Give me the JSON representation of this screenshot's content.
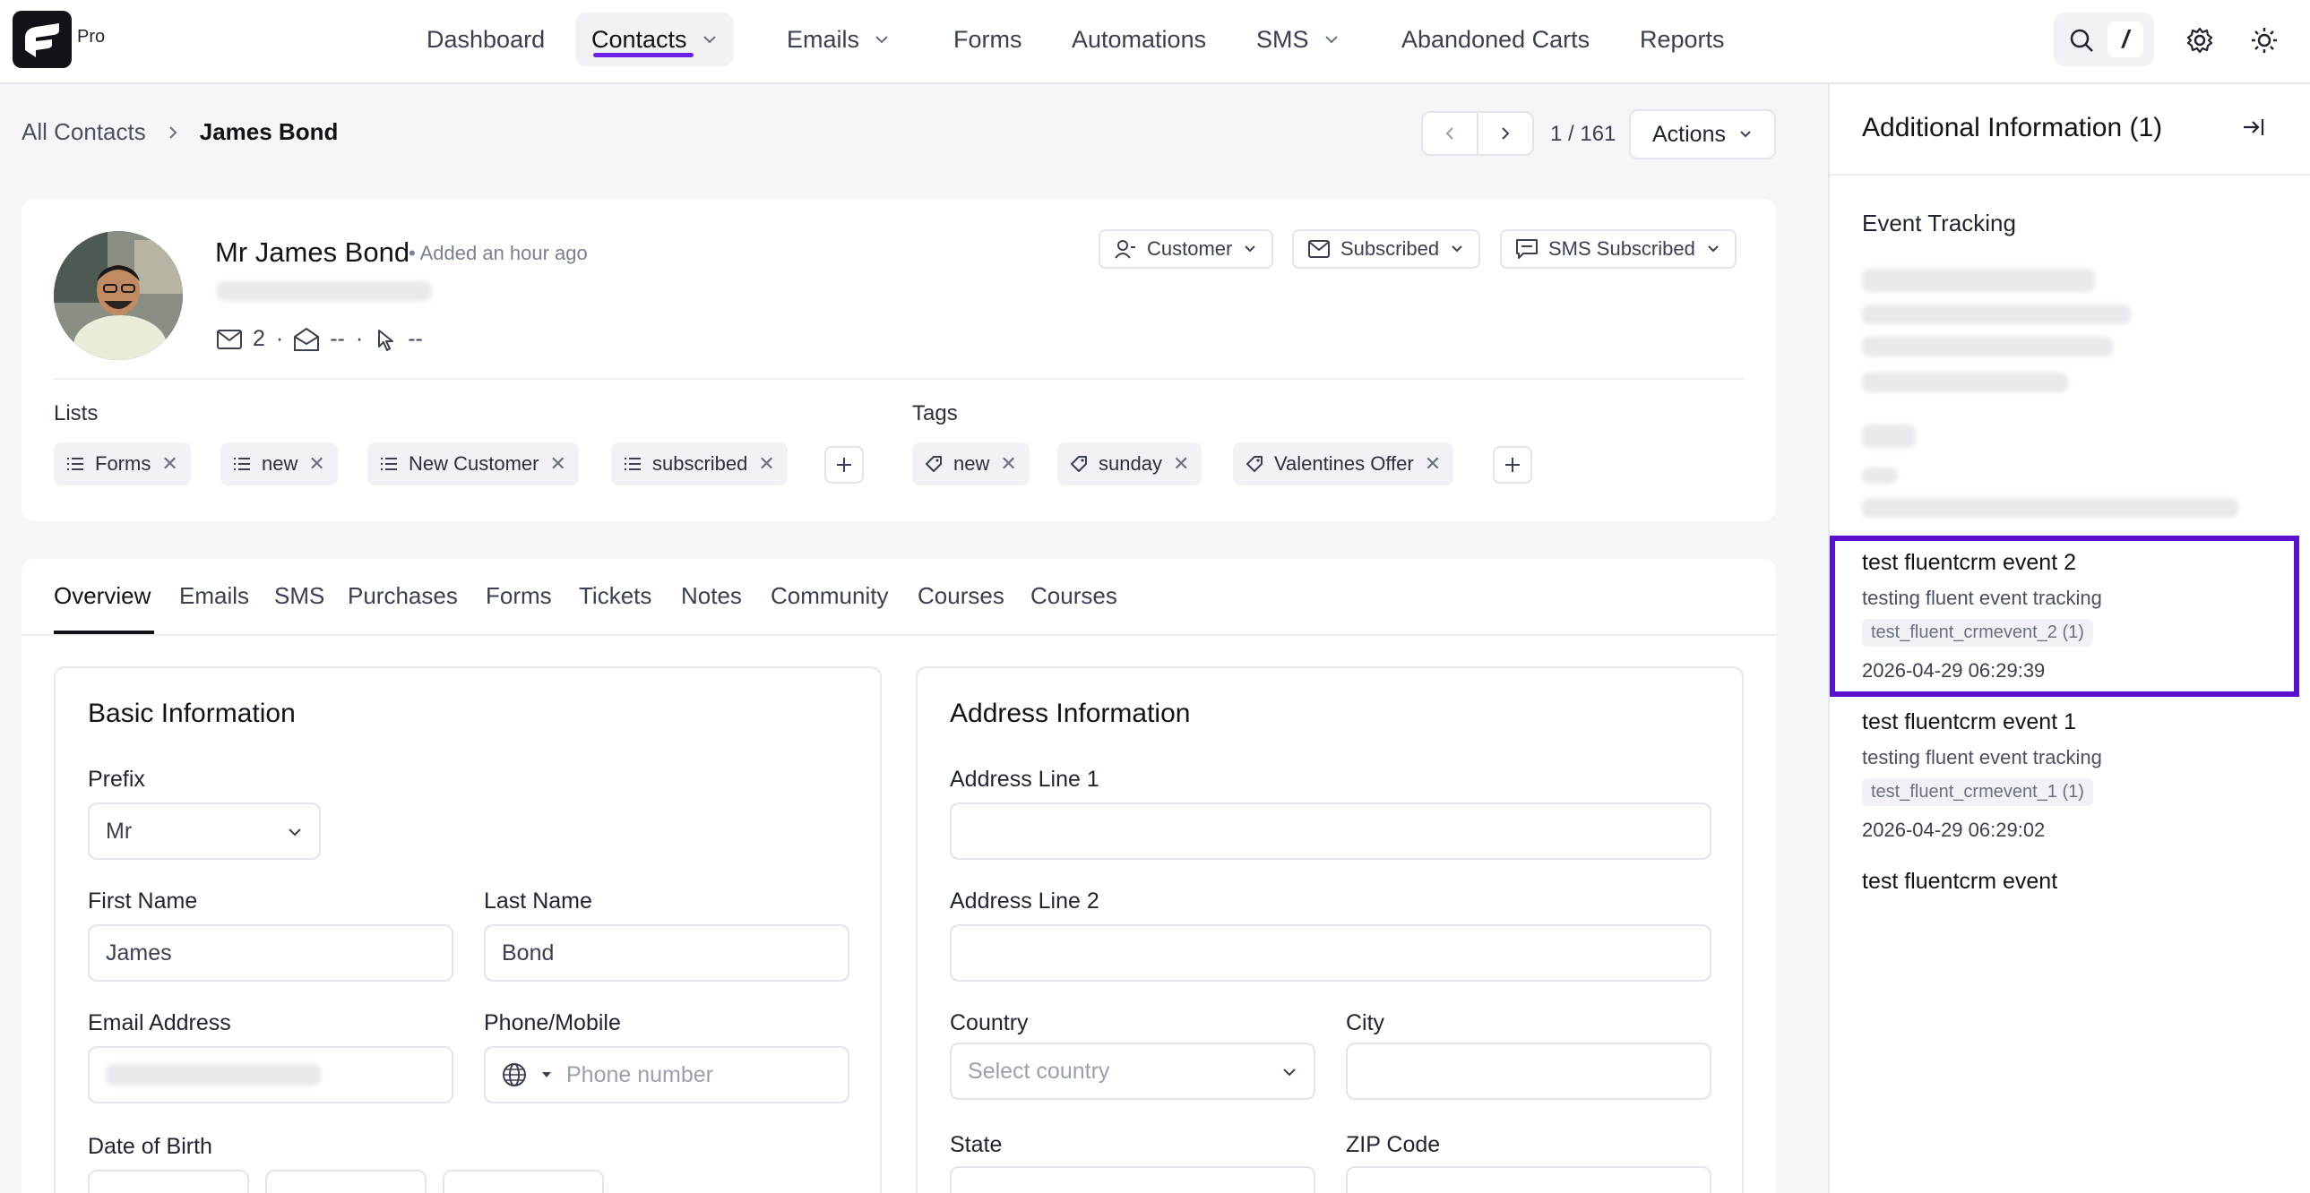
{
  "app": {
    "logo_badge": "Pro"
  },
  "nav": {
    "items": [
      {
        "label": "Dashboard"
      },
      {
        "label": "Contacts"
      },
      {
        "label": "Emails"
      },
      {
        "label": "Forms"
      },
      {
        "label": "Automations"
      },
      {
        "label": "SMS"
      },
      {
        "label": "Abandoned Carts"
      },
      {
        "label": "Reports"
      }
    ],
    "shortcut_key": "/"
  },
  "breadcrumb": {
    "parent": "All Contacts",
    "current": "James Bond"
  },
  "pager": {
    "count": "1 / 161"
  },
  "actions": {
    "label": "Actions"
  },
  "contact": {
    "name": "Mr James Bond",
    "added": "• Added an hour ago",
    "stats": {
      "emails_sent": "2",
      "opens": "--",
      "clicks": "--"
    },
    "status": {
      "type": "Customer",
      "email": "Subscribed",
      "sms": "SMS Subscribed"
    }
  },
  "lists": {
    "label": "Lists",
    "items": [
      "Forms",
      "new",
      "New Customer",
      "subscribed"
    ]
  },
  "tags": {
    "label": "Tags",
    "items": [
      "new",
      "sunday",
      "Valentines Offer"
    ]
  },
  "tabs": [
    "Overview",
    "Emails",
    "SMS",
    "Purchases",
    "Forms",
    "Tickets",
    "Notes",
    "Community",
    "Courses",
    "Courses"
  ],
  "basic_info": {
    "title": "Basic Information",
    "prefix_label": "Prefix",
    "prefix_value": "Mr",
    "first_name_label": "First Name",
    "first_name_value": "James",
    "last_name_label": "Last Name",
    "last_name_value": "Bond",
    "email_label": "Email Address",
    "phone_label": "Phone/Mobile",
    "phone_placeholder": "Phone number",
    "dob_label": "Date of Birth"
  },
  "address_info": {
    "title": "Address Information",
    "line1_label": "Address Line 1",
    "line2_label": "Address Line 2",
    "country_label": "Country",
    "country_placeholder": "Select country",
    "city_label": "City",
    "state_label": "State",
    "zip_label": "ZIP Code"
  },
  "sidebar": {
    "title": "Additional Information (1)",
    "heading": "Event Tracking",
    "events": [
      {
        "title": "test fluentcrm event 2",
        "desc": "testing fluent event tracking",
        "key": "test_fluent_crmevent_2 (1)",
        "date": "2026-04-29 06:29:39"
      },
      {
        "title": "test fluentcrm event 1",
        "desc": "testing fluent event tracking",
        "key": "test_fluent_crmevent_1 (1)",
        "date": "2026-04-29 06:29:02"
      },
      {
        "title": "test fluentcrm event"
      }
    ],
    "highlight_color": "#5a12cf"
  },
  "colors": {
    "accent": "#6b21e8"
  }
}
